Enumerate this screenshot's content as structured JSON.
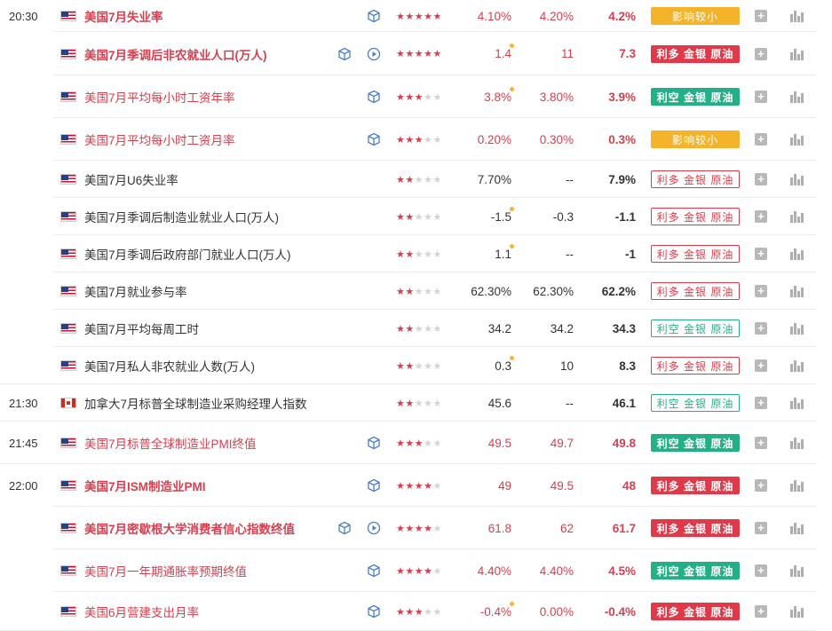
{
  "rows": [
    {
      "time": "20:30",
      "flag": "us",
      "name": "美国7月失业率",
      "name_color": "red",
      "bold": true,
      "has_cube": true,
      "has_play": false,
      "stars": 5,
      "prev": "4.10%",
      "prev_dot": false,
      "forecast": "4.20%",
      "actual": "4.2%",
      "value_color": "red",
      "badge": "影响较小",
      "badge_style": "s-yellow",
      "group_start": true
    },
    {
      "time": "",
      "flag": "us",
      "name": "美国7月季调后非农就业人口(万人)",
      "name_color": "red",
      "bold": true,
      "has_cube": true,
      "has_play": true,
      "stars": 5,
      "prev": "1.4",
      "prev_dot": true,
      "forecast": "11",
      "actual": "7.3",
      "value_color": "red",
      "badge": "利多 金银 原油",
      "badge_style": "s-red"
    },
    {
      "time": "",
      "flag": "us",
      "name": "美国7月平均每小时工资年率",
      "name_color": "red",
      "bold": false,
      "has_cube": true,
      "has_play": false,
      "stars": 3,
      "prev": "3.8%",
      "prev_dot": true,
      "forecast": "3.80%",
      "actual": "3.9%",
      "value_color": "red",
      "badge": "利空 金银 原油",
      "badge_style": "s-green"
    },
    {
      "time": "",
      "flag": "us",
      "name": "美国7月平均每小时工资月率",
      "name_color": "red",
      "bold": false,
      "has_cube": true,
      "has_play": false,
      "stars": 3,
      "prev": "0.20%",
      "prev_dot": false,
      "forecast": "0.30%",
      "actual": "0.3%",
      "value_color": "red",
      "badge": "影响较小",
      "badge_style": "s-yellow"
    },
    {
      "time": "",
      "flag": "us",
      "name": "美国7月U6失业率",
      "name_color": "dark",
      "bold": false,
      "has_cube": false,
      "has_play": false,
      "stars": 2,
      "prev": "7.70%",
      "prev_dot": false,
      "forecast": "--",
      "actual": "7.9%",
      "value_color": "dark",
      "badge": "利多 金银 原油",
      "badge_style": "o-red"
    },
    {
      "time": "",
      "flag": "us",
      "name": "美国7月季调后制造业就业人口(万人)",
      "name_color": "dark",
      "bold": false,
      "has_cube": false,
      "has_play": false,
      "stars": 2,
      "prev": "-1.5",
      "prev_dot": true,
      "forecast": "-0.3",
      "actual": "-1.1",
      "value_color": "dark",
      "badge": "利多 金银 原油",
      "badge_style": "o-red"
    },
    {
      "time": "",
      "flag": "us",
      "name": "美国7月季调后政府部门就业人口(万人)",
      "name_color": "dark",
      "bold": false,
      "has_cube": false,
      "has_play": false,
      "stars": 2,
      "prev": "1.1",
      "prev_dot": true,
      "forecast": "--",
      "actual": "-1",
      "value_color": "dark",
      "badge": "利多 金银 原油",
      "badge_style": "o-red"
    },
    {
      "time": "",
      "flag": "us",
      "name": "美国7月就业参与率",
      "name_color": "dark",
      "bold": false,
      "has_cube": false,
      "has_play": false,
      "stars": 2,
      "prev": "62.30%",
      "prev_dot": false,
      "forecast": "62.30%",
      "actual": "62.2%",
      "value_color": "dark",
      "badge": "利多 金银 原油",
      "badge_style": "o-red"
    },
    {
      "time": "",
      "flag": "us",
      "name": "美国7月平均每周工时",
      "name_color": "dark",
      "bold": false,
      "has_cube": false,
      "has_play": false,
      "stars": 2,
      "prev": "34.2",
      "prev_dot": false,
      "forecast": "34.2",
      "actual": "34.3",
      "value_color": "dark",
      "badge": "利空 金银 原油",
      "badge_style": "o-green"
    },
    {
      "time": "",
      "flag": "us",
      "name": "美国7月私人非农就业人数(万人)",
      "name_color": "dark",
      "bold": false,
      "has_cube": false,
      "has_play": false,
      "stars": 2,
      "prev": "0.3",
      "prev_dot": true,
      "forecast": "10",
      "actual": "8.3",
      "value_color": "dark",
      "badge": "利多 金银 原油",
      "badge_style": "o-red",
      "group_end": true
    },
    {
      "time": "21:30",
      "flag": "ca",
      "name": "加拿大7月标普全球制造业采购经理人指数",
      "name_color": "dark",
      "bold": false,
      "has_cube": false,
      "has_play": false,
      "stars": 2,
      "prev": "45.6",
      "prev_dot": false,
      "forecast": "--",
      "actual": "46.1",
      "value_color": "dark",
      "badge": "利空 金银 原油",
      "badge_style": "o-green",
      "group_end": true
    },
    {
      "time": "21:45",
      "flag": "us",
      "name": "美国7月标普全球制造业PMI终值",
      "name_color": "red",
      "bold": false,
      "has_cube": true,
      "has_play": false,
      "stars": 3,
      "prev": "49.5",
      "prev_dot": false,
      "forecast": "49.7",
      "actual": "49.8",
      "value_color": "red",
      "badge": "利空 金银 原油",
      "badge_style": "s-green",
      "group_end": true
    },
    {
      "time": "22:00",
      "flag": "us",
      "name": "美国7月ISM制造业PMI",
      "name_color": "red",
      "bold": true,
      "has_cube": true,
      "has_play": false,
      "stars": 4,
      "prev": "49",
      "prev_dot": false,
      "forecast": "49.5",
      "actual": "48",
      "value_color": "red",
      "badge": "利多 金银 原油",
      "badge_style": "s-red"
    },
    {
      "time": "",
      "flag": "us",
      "name": "美国7月密歇根大学消费者信心指数终值",
      "name_color": "red",
      "bold": true,
      "has_cube": true,
      "has_play": true,
      "stars": 4,
      "prev": "61.8",
      "prev_dot": false,
      "forecast": "62",
      "actual": "61.7",
      "value_color": "red",
      "badge": "利多 金银 原油",
      "badge_style": "s-red"
    },
    {
      "time": "",
      "flag": "us",
      "name": "美国7月一年期通胀率预期终值",
      "name_color": "red",
      "bold": false,
      "has_cube": true,
      "has_play": false,
      "stars": 4,
      "prev": "4.40%",
      "prev_dot": false,
      "forecast": "4.40%",
      "actual": "4.5%",
      "value_color": "red",
      "badge": "利空 金银 原油",
      "badge_style": "s-green"
    },
    {
      "time": "",
      "flag": "us",
      "name": "美国6月营建支出月率",
      "name_color": "red",
      "bold": false,
      "has_cube": true,
      "has_play": false,
      "stars": 3,
      "prev": "-0.4%",
      "prev_dot": true,
      "forecast": "0.00%",
      "actual": "-0.4%",
      "value_color": "red",
      "badge": "利多 金银 原油",
      "badge_style": "s-red"
    }
  ]
}
